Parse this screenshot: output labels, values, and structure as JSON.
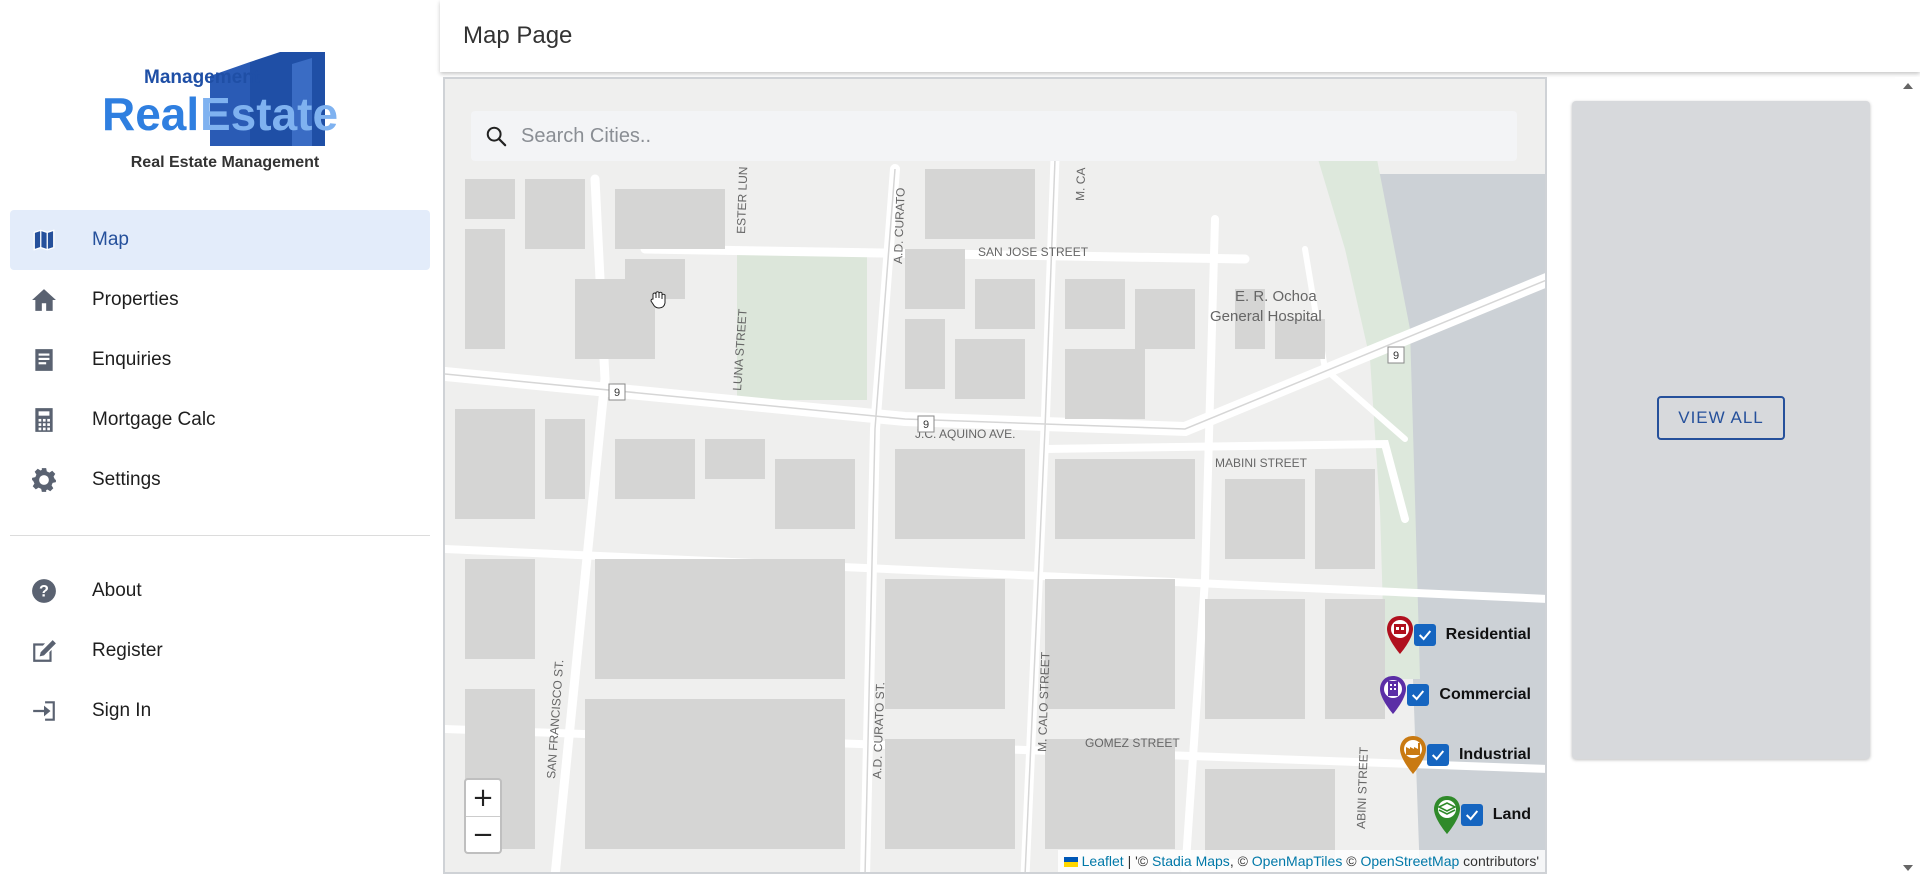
{
  "brand": {
    "logo_top": "Management",
    "logo_main_left": "Real",
    "logo_main_right": "Estate",
    "caption": "Real Estate Management"
  },
  "nav": {
    "primary": [
      {
        "label": "Map",
        "icon": "map-icon",
        "active": true
      },
      {
        "label": "Properties",
        "icon": "home-icon",
        "active": false
      },
      {
        "label": "Enquiries",
        "icon": "document-icon",
        "active": false
      },
      {
        "label": "Mortgage Calc",
        "icon": "calculator-icon",
        "active": false
      },
      {
        "label": "Settings",
        "icon": "gear-icon",
        "active": false
      }
    ],
    "secondary": [
      {
        "label": "About",
        "icon": "help-icon"
      },
      {
        "label": "Register",
        "icon": "edit-icon"
      },
      {
        "label": "Sign In",
        "icon": "sign-in-icon"
      }
    ]
  },
  "header": {
    "title": "Map Page"
  },
  "search": {
    "placeholder": "Search Cities.."
  },
  "map": {
    "streets": [
      "SAN JOSE STREET",
      "J.C. AQUINO AVE.",
      "MABINI STREET",
      "GOMEZ STREET",
      "LUNA STREET",
      "A.D. CURATO",
      "A.D. CURATO ST.",
      "SAN FRANCISCO ST.",
      "M. CALO STREET",
      "ESTER LUN",
      "ABINI STREET",
      "M. CA"
    ],
    "places": [
      "E. R. Ochoa",
      "General Hospital"
    ],
    "route_shield": "9"
  },
  "legend": [
    {
      "label": "Residential",
      "color": "#b0101e",
      "checked": true
    },
    {
      "label": "Commercial",
      "color": "#5b2ea6",
      "checked": true
    },
    {
      "label": "Industrial",
      "color": "#c97a12",
      "checked": true
    },
    {
      "label": "Land",
      "color": "#2f8a2a",
      "checked": true
    }
  ],
  "zoom": {
    "in": "+",
    "out": "−"
  },
  "attribution": {
    "leaflet": "Leaflet",
    "sep1": " | '© ",
    "stadia": "Stadia Maps",
    "sep2": ", © ",
    "omt": "OpenMapTiles",
    "sep3": " © ",
    "osm": "OpenStreetMap",
    "tail": " contributors'"
  },
  "panel": {
    "button": "VIEW ALL"
  },
  "colors": {
    "accent": "#25509b",
    "active_bg": "#e3ecfa",
    "checkbox": "#1565c0"
  }
}
